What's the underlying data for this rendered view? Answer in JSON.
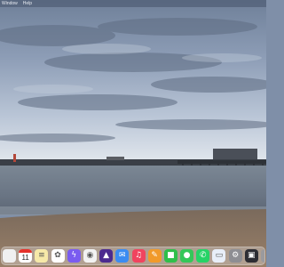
{
  "menubar": {
    "items": [
      "Window",
      "Help"
    ]
  },
  "dock": {
    "calendar_day": "11",
    "items": [
      {
        "name": "partial-app-icon",
        "color": "#f0f0f0",
        "glyph": ""
      },
      {
        "name": "calendar-icon",
        "color": "#ffffff",
        "glyph": ""
      },
      {
        "name": "notes-icon",
        "color": "#f6e9a8",
        "glyph": "≡"
      },
      {
        "name": "photos-icon",
        "color": "#ffffff",
        "glyph": "✿"
      },
      {
        "name": "messenger-icon",
        "color": "#7a5cf0",
        "glyph": "ϟ"
      },
      {
        "name": "safari-icon",
        "color": "#f2f2f2",
        "glyph": "◉"
      },
      {
        "name": "affinity-icon",
        "color": "#4b2a8f",
        "glyph": "▲"
      },
      {
        "name": "mail-icon",
        "color": "#3b8cf2",
        "glyph": "✉"
      },
      {
        "name": "music-icon",
        "color": "#f0445f",
        "glyph": "♫"
      },
      {
        "name": "pages-icon",
        "color": "#f19a2a",
        "glyph": "✎"
      },
      {
        "name": "facetime-icon",
        "color": "#2fbf4a",
        "glyph": "■"
      },
      {
        "name": "messages-icon",
        "color": "#34c759",
        "glyph": "●"
      },
      {
        "name": "whatsapp-icon",
        "color": "#25d366",
        "glyph": "✆"
      },
      {
        "name": "preview-icon",
        "color": "#e8eef8",
        "glyph": "▭"
      },
      {
        "name": "settings-icon",
        "color": "#8e8e93",
        "glyph": "⚙"
      },
      {
        "name": "app-store-icon",
        "color": "#2d2d33",
        "glyph": "▣"
      },
      {
        "name": "calculator-icon",
        "color": "#9a9a9e",
        "glyph": "⊞"
      },
      {
        "name": "trash-icon",
        "color": "#d7dde6",
        "glyph": "▯"
      }
    ]
  },
  "colors": {
    "sky_top": "#8a9bb6",
    "sky_horizon": "#dfe6ef",
    "sea": "#5f6f80",
    "sand": "#8a7460"
  }
}
